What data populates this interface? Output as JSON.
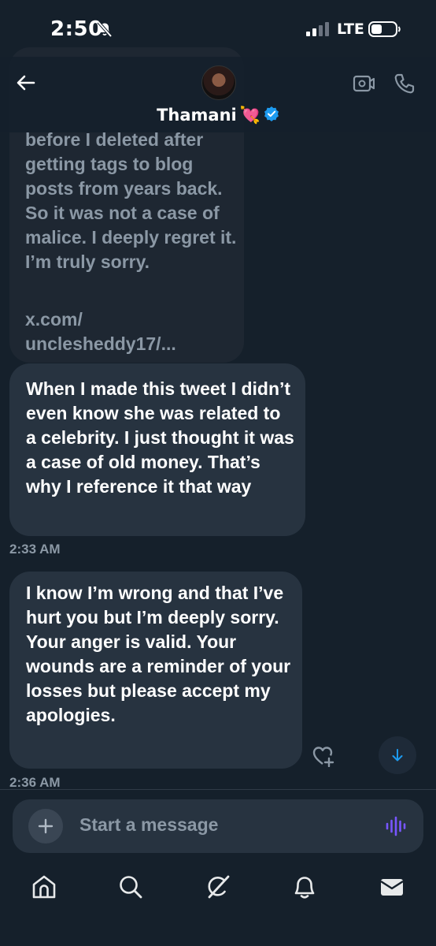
{
  "status_bar": {
    "time": "2:50",
    "network": "LTE"
  },
  "header": {
    "contact_name": "Thamani",
    "name_emoji": "💘"
  },
  "messages": {
    "quoted": {
      "text": "before I deleted after getting tags to blog posts from years back. So it was not a case of malice. I deeply regret it. I’m truly sorry.",
      "link": "x.com/ unclesheddy17/..."
    },
    "items": [
      {
        "text": "When I made this tweet I didn’t even know she was related to a celebrity. I just thought it was a case of old money. That’s why I reference it that way",
        "time": "2:33 AM"
      },
      {
        "text": "I know I’m wrong and that I’ve hurt you but I’m deeply sorry. Your anger is valid. Your wounds are a reminder of your losses but please accept my apologies.",
        "time": "2:36 AM"
      }
    ]
  },
  "composer": {
    "placeholder": "Start a message"
  },
  "icons": {
    "back": "back-arrow-icon",
    "video": "video-call-icon",
    "phone": "phone-call-icon",
    "verified": "verified-badge-icon",
    "react": "add-reaction-icon",
    "scroll": "scroll-down-icon",
    "plus": "plus-icon",
    "voice": "voice-message-icon",
    "tabs": [
      "home-icon",
      "search-icon",
      "grok-icon",
      "notifications-icon",
      "messages-icon"
    ]
  },
  "colors": {
    "background": "#15202b",
    "bubble": "#273340",
    "accent": "#1d9bf0",
    "voice_accent": "#7856ff",
    "muted": "#8b98a5"
  }
}
